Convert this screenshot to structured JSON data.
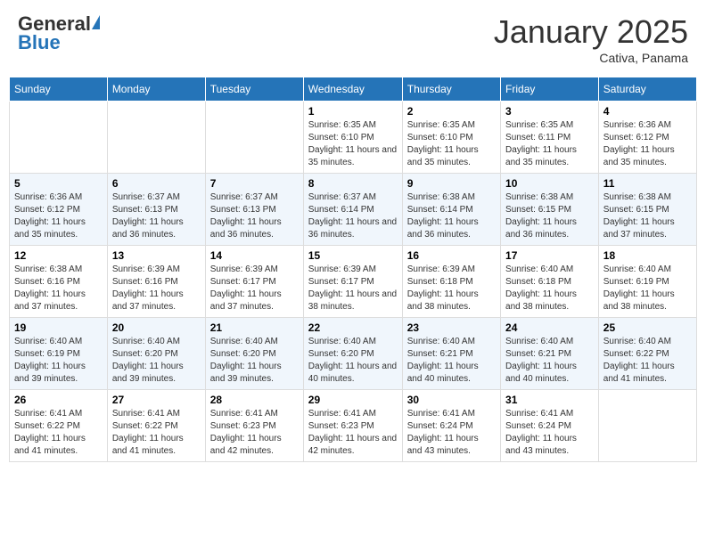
{
  "header": {
    "logo_general": "General",
    "logo_blue": "Blue",
    "month_title": "January 2025",
    "location": "Cativa, Panama"
  },
  "weekdays": [
    "Sunday",
    "Monday",
    "Tuesday",
    "Wednesday",
    "Thursday",
    "Friday",
    "Saturday"
  ],
  "weeks": [
    [
      {
        "day": "",
        "info": ""
      },
      {
        "day": "",
        "info": ""
      },
      {
        "day": "",
        "info": ""
      },
      {
        "day": "1",
        "info": "Sunrise: 6:35 AM\nSunset: 6:10 PM\nDaylight: 11 hours and 35 minutes."
      },
      {
        "day": "2",
        "info": "Sunrise: 6:35 AM\nSunset: 6:10 PM\nDaylight: 11 hours and 35 minutes."
      },
      {
        "day": "3",
        "info": "Sunrise: 6:35 AM\nSunset: 6:11 PM\nDaylight: 11 hours and 35 minutes."
      },
      {
        "day": "4",
        "info": "Sunrise: 6:36 AM\nSunset: 6:12 PM\nDaylight: 11 hours and 35 minutes."
      }
    ],
    [
      {
        "day": "5",
        "info": "Sunrise: 6:36 AM\nSunset: 6:12 PM\nDaylight: 11 hours and 35 minutes."
      },
      {
        "day": "6",
        "info": "Sunrise: 6:37 AM\nSunset: 6:13 PM\nDaylight: 11 hours and 36 minutes."
      },
      {
        "day": "7",
        "info": "Sunrise: 6:37 AM\nSunset: 6:13 PM\nDaylight: 11 hours and 36 minutes."
      },
      {
        "day": "8",
        "info": "Sunrise: 6:37 AM\nSunset: 6:14 PM\nDaylight: 11 hours and 36 minutes."
      },
      {
        "day": "9",
        "info": "Sunrise: 6:38 AM\nSunset: 6:14 PM\nDaylight: 11 hours and 36 minutes."
      },
      {
        "day": "10",
        "info": "Sunrise: 6:38 AM\nSunset: 6:15 PM\nDaylight: 11 hours and 36 minutes."
      },
      {
        "day": "11",
        "info": "Sunrise: 6:38 AM\nSunset: 6:15 PM\nDaylight: 11 hours and 37 minutes."
      }
    ],
    [
      {
        "day": "12",
        "info": "Sunrise: 6:38 AM\nSunset: 6:16 PM\nDaylight: 11 hours and 37 minutes."
      },
      {
        "day": "13",
        "info": "Sunrise: 6:39 AM\nSunset: 6:16 PM\nDaylight: 11 hours and 37 minutes."
      },
      {
        "day": "14",
        "info": "Sunrise: 6:39 AM\nSunset: 6:17 PM\nDaylight: 11 hours and 37 minutes."
      },
      {
        "day": "15",
        "info": "Sunrise: 6:39 AM\nSunset: 6:17 PM\nDaylight: 11 hours and 38 minutes."
      },
      {
        "day": "16",
        "info": "Sunrise: 6:39 AM\nSunset: 6:18 PM\nDaylight: 11 hours and 38 minutes."
      },
      {
        "day": "17",
        "info": "Sunrise: 6:40 AM\nSunset: 6:18 PM\nDaylight: 11 hours and 38 minutes."
      },
      {
        "day": "18",
        "info": "Sunrise: 6:40 AM\nSunset: 6:19 PM\nDaylight: 11 hours and 38 minutes."
      }
    ],
    [
      {
        "day": "19",
        "info": "Sunrise: 6:40 AM\nSunset: 6:19 PM\nDaylight: 11 hours and 39 minutes."
      },
      {
        "day": "20",
        "info": "Sunrise: 6:40 AM\nSunset: 6:20 PM\nDaylight: 11 hours and 39 minutes."
      },
      {
        "day": "21",
        "info": "Sunrise: 6:40 AM\nSunset: 6:20 PM\nDaylight: 11 hours and 39 minutes."
      },
      {
        "day": "22",
        "info": "Sunrise: 6:40 AM\nSunset: 6:20 PM\nDaylight: 11 hours and 40 minutes."
      },
      {
        "day": "23",
        "info": "Sunrise: 6:40 AM\nSunset: 6:21 PM\nDaylight: 11 hours and 40 minutes."
      },
      {
        "day": "24",
        "info": "Sunrise: 6:40 AM\nSunset: 6:21 PM\nDaylight: 11 hours and 40 minutes."
      },
      {
        "day": "25",
        "info": "Sunrise: 6:40 AM\nSunset: 6:22 PM\nDaylight: 11 hours and 41 minutes."
      }
    ],
    [
      {
        "day": "26",
        "info": "Sunrise: 6:41 AM\nSunset: 6:22 PM\nDaylight: 11 hours and 41 minutes."
      },
      {
        "day": "27",
        "info": "Sunrise: 6:41 AM\nSunset: 6:22 PM\nDaylight: 11 hours and 41 minutes."
      },
      {
        "day": "28",
        "info": "Sunrise: 6:41 AM\nSunset: 6:23 PM\nDaylight: 11 hours and 42 minutes."
      },
      {
        "day": "29",
        "info": "Sunrise: 6:41 AM\nSunset: 6:23 PM\nDaylight: 11 hours and 42 minutes."
      },
      {
        "day": "30",
        "info": "Sunrise: 6:41 AM\nSunset: 6:24 PM\nDaylight: 11 hours and 43 minutes."
      },
      {
        "day": "31",
        "info": "Sunrise: 6:41 AM\nSunset: 6:24 PM\nDaylight: 11 hours and 43 minutes."
      },
      {
        "day": "",
        "info": ""
      }
    ]
  ]
}
